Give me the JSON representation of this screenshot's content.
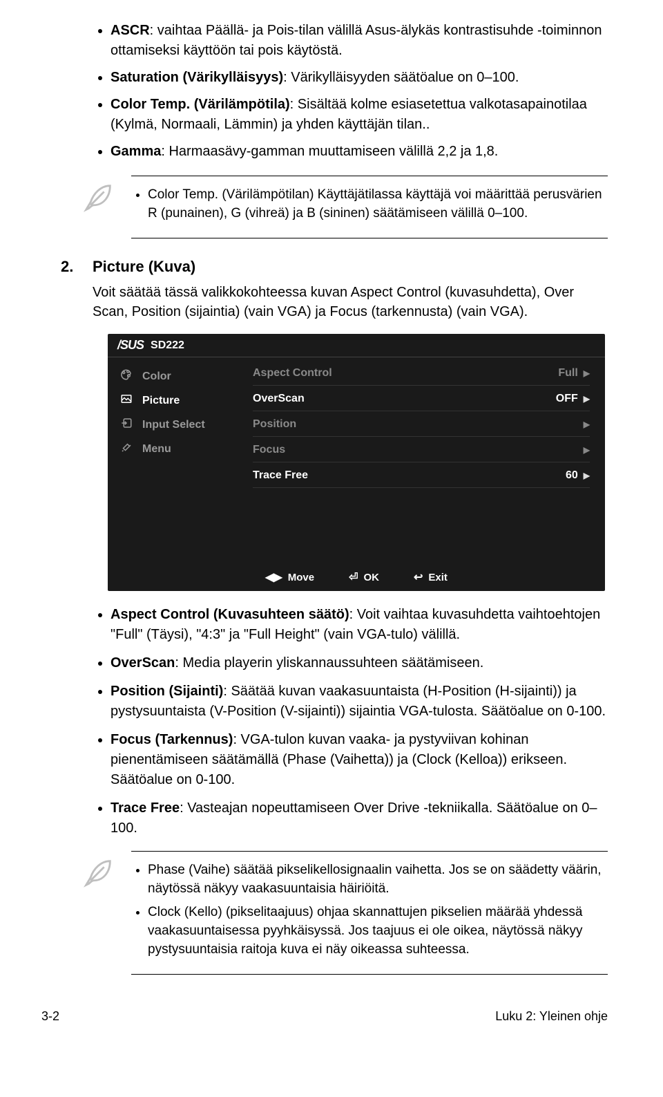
{
  "top": {
    "items": [
      {
        "lead": "ASCR",
        "text": ": vaihtaa Päällä- ja Pois-tilan välillä Asus-älykäs kontrastisuhde -toiminnon ottamiseksi käyttöön tai pois käytöstä."
      },
      {
        "lead": "Saturation (Värikylläisyys)",
        "text": ": Värikylläisyyden säätöalue on 0–100."
      },
      {
        "lead": "Color Temp. (Värilämpötila)",
        "text": ": Sisältää kolme esiasetettua valkotasapainotilaa (Kylmä, Normaali, Lämmin) ja yhden käyttäjän tilan.."
      },
      {
        "lead": "Gamma",
        "text": ": Harmaasävy-gamman muuttamiseen välillä 2,2 ja 1,8."
      }
    ]
  },
  "note1": {
    "text": "Color Temp. (Värilämpötilan) Käyttäjätilassa käyttäjä voi määrittää perusvärien R (punainen), G (vihreä) ja B (sininen) säätämiseen välillä 0–100."
  },
  "section": {
    "num": "2.",
    "title": "Picture (Kuva)",
    "text": "Voit säätää tässä valikkokohteessa kuvan Aspect Control (kuvasuhdetta), Over Scan, Position (sijaintia) (vain VGA) ja Focus (tarkennusta) (vain VGA)."
  },
  "osd": {
    "logo": "/SUS",
    "model": "SD222",
    "nav": [
      {
        "label": "Color",
        "icon": "palette-icon",
        "active": false
      },
      {
        "label": "Picture",
        "icon": "picture-icon",
        "active": true
      },
      {
        "label": "Input Select",
        "icon": "input-icon",
        "active": false
      },
      {
        "label": "Menu",
        "icon": "tools-icon",
        "active": false
      }
    ],
    "settings": [
      {
        "label": "Aspect Control",
        "value": "Full",
        "enabled": false
      },
      {
        "label": "OverScan",
        "value": "OFF",
        "enabled": true
      },
      {
        "label": "Position",
        "value": "",
        "enabled": false
      },
      {
        "label": "Focus",
        "value": "",
        "enabled": false
      },
      {
        "label": "Trace Free",
        "value": "60",
        "enabled": true
      }
    ],
    "footer": {
      "move": "Move",
      "ok": "OK",
      "exit": "Exit"
    }
  },
  "bottom": {
    "items": [
      {
        "lead": "Aspect Control (Kuvasuhteen säätö)",
        "text": ": Voit vaihtaa kuvasuhdetta vaihtoehtojen \"Full\" (Täysi), \"4:3\" ja \"Full Height\" (vain VGA-tulo) välillä."
      },
      {
        "lead": "OverScan",
        "text": ": Media playerin yliskannaussuhteen säätämiseen."
      },
      {
        "lead": "Position (Sijainti)",
        "text": ": Säätää kuvan vaakasuuntaista (H-Position (H-sijainti)) ja pystysuuntaista (V-Position (V-sijainti)) sijaintia VGA-tulosta. Säätöalue on 0-100."
      },
      {
        "lead": "Focus (Tarkennus)",
        "text": ": VGA-tulon kuvan vaaka- ja pystyviivan kohinan pienentämiseen säätämällä (Phase (Vaihetta)) ja (Clock (Kelloa)) erikseen. Säätöalue on 0-100."
      },
      {
        "lead": "Trace Free",
        "text": ": Vasteajan nopeuttamiseen Over Drive -tekniikalla. Säätöalue on 0–100."
      }
    ]
  },
  "note2": {
    "items": [
      "Phase (Vaihe) säätää pikselikellosignaalin vaihetta. Jos se on säädetty väärin, näytössä näkyy vaakasuuntaisia häiriöitä.",
      "Clock (Kello) (pikselitaajuus) ohjaa skannattujen pikselien määrää yhdessä vaakasuuntaisessa pyyhkäisyssä. Jos taajuus ei ole oikea, näytössä näkyy pystysuuntaisia raitoja kuva ei näy oikeassa suhteessa."
    ]
  },
  "footer": {
    "page": "3-2",
    "chapter": "Luku 2: Yleinen ohje"
  }
}
